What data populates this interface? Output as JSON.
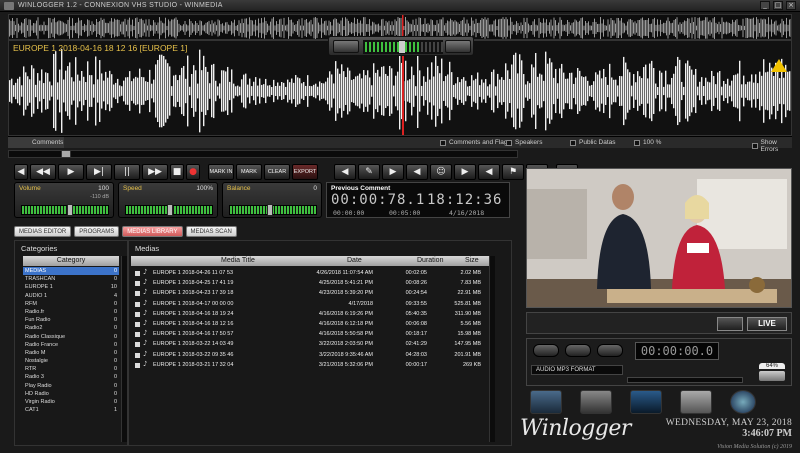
{
  "window": {
    "title": "WINLOGGER 1.2 - CONNEXION VHS STUDIO - WINMEDIA",
    "buttons": [
      "_",
      "□",
      "×"
    ]
  },
  "waveform": {
    "label": "EUROPE 1 2018-04-16 18 12 16 [EUROPE 1]",
    "warning_icon": "warning-triangle-icon"
  },
  "status": {
    "comments_tab": "Comments",
    "comments_and_flags": "Comments and Flags",
    "speakers": "Speakers",
    "public_datas": "Public Datas",
    "zoom": "100 %",
    "show_errors": "Show Errors"
  },
  "transport": {
    "buttons": [
      "◀",
      "◀◀",
      "▶",
      "▶|",
      "||",
      "▶▶",
      "■",
      "●"
    ],
    "marks": [
      "MARK IN",
      "MARK OUT",
      "CLEAR",
      "EXPORT"
    ]
  },
  "mixer": {
    "volume": {
      "label": "Volume",
      "value": "100",
      "sub": "-110 dB",
      "level": 0.55
    },
    "speed": {
      "label": "Speed",
      "value": "100%",
      "level": 0.5
    },
    "balance": {
      "label": "Balance",
      "value": "0",
      "level": 0.45
    }
  },
  "clock": {
    "label": "Previous Comment",
    "position": "00:00:78.1",
    "time": "18:12:36",
    "sub1": "00:00:00",
    "sub2": "00:05:00",
    "date": "4/16/2018"
  },
  "tabs": [
    {
      "label": "MEDIAS EDITOR",
      "active": false
    },
    {
      "label": "PROGRAMS",
      "active": false
    },
    {
      "label": "MEDIAS LIBRARY",
      "active": true
    },
    {
      "label": "MEDIAS SCAN",
      "active": false
    }
  ],
  "categories": {
    "title": "Categories",
    "header": "Category",
    "items": [
      {
        "name": "MEDIAS",
        "count": "0"
      },
      {
        "name": "TRASHCAN",
        "count": "0"
      },
      {
        "name": "EUROPE 1",
        "count": "10"
      },
      {
        "name": "AUDIO 1",
        "count": "4"
      },
      {
        "name": "RFM",
        "count": "0"
      },
      {
        "name": "Radio.fr",
        "count": "0"
      },
      {
        "name": "Fun Radio",
        "count": "0"
      },
      {
        "name": "Radio2",
        "count": "0"
      },
      {
        "name": "Radio Classique",
        "count": "0"
      },
      {
        "name": "Radio France",
        "count": "0"
      },
      {
        "name": "Radio M",
        "count": "0"
      },
      {
        "name": "Nostalgie",
        "count": "0"
      },
      {
        "name": "RTR",
        "count": "0"
      },
      {
        "name": "Radio 3",
        "count": "0"
      },
      {
        "name": "Play Radio",
        "count": "0"
      },
      {
        "name": "HD Radio",
        "count": "0"
      },
      {
        "name": "Virgin Radio",
        "count": "0"
      },
      {
        "name": "CAT1",
        "count": "1"
      }
    ]
  },
  "medias": {
    "title": "Medias",
    "columns": [
      "Media Title",
      "Date",
      "Duration",
      "Size"
    ],
    "rows": [
      {
        "title": "EUROPE 1 2018-04-26 11 07 53",
        "date": "4/26/2018 11:07:54 AM",
        "duration": "00:02:05",
        "size": "2.02 MB"
      },
      {
        "title": "EUROPE 1 2018-04-25 17 41 19",
        "date": "4/25/2018 5:41:21 PM",
        "duration": "00:08:26",
        "size": "7.83 MB"
      },
      {
        "title": "EUROPE 1 2018-04-23 17 39 18",
        "date": "4/23/2018 5:39:20 PM",
        "duration": "00:24:54",
        "size": "22.91 MB"
      },
      {
        "title": "EUROPE 1 2018-04-17 00 00 00",
        "date": "4/17/2018",
        "duration": "09:33:55",
        "size": "525.81 MB"
      },
      {
        "title": "EUROPE 1 2018-04-16 18 19 24",
        "date": "4/16/2018 6:19:26 PM",
        "duration": "05:40:35",
        "size": "311.90 MB"
      },
      {
        "title": "EUROPE 1 2018-04-16 18 12 16",
        "date": "4/16/2018 6:12:18 PM",
        "duration": "00:06:08",
        "size": "5.56 MB"
      },
      {
        "title": "EUROPE 1 2018-04-16 17 50 57",
        "date": "4/16/2018 5:50:58 PM",
        "duration": "00:18:17",
        "size": "15.98 MB"
      },
      {
        "title": "EUROPE 1 2018-03-22 14 03 49",
        "date": "3/22/2018 2:03:50 PM",
        "duration": "02:41:29",
        "size": "147.95 MB"
      },
      {
        "title": "EUROPE 1 2018-03-22 09 35 46",
        "date": "3/22/2018 9:35:46 AM",
        "duration": "04:28:03",
        "size": "201.91 MB"
      },
      {
        "title": "EUROPE 1 2018-03-21 17 32 04",
        "date": "3/21/2018 5:32:06 PM",
        "duration": "00:00:17",
        "size": "269 KB"
      }
    ]
  },
  "video": {
    "live_label": "LIVE",
    "camera_icon": "camera-icon"
  },
  "recorder": {
    "clock": "00:00:00.0",
    "format": "AUDIO MP3 FORMAT",
    "disk_percent": "64%",
    "disk_icon": "hard-disk-icon"
  },
  "dock_icons": [
    "video-wall-icon",
    "microphone-icon",
    "monitor-icon",
    "settings-icon",
    "globe-icon"
  ],
  "footer": {
    "brand": "Winlogger",
    "date": "WEDNESDAY, MAY 23, 2018",
    "time": "3:46:07 PM",
    "credit": "Vision Media Solution (c) 2019"
  },
  "colors": {
    "accent_gold": "#e6c14a",
    "selection_blue": "#3c73c9",
    "active_tab": "#d05a5a",
    "cursor_red": "#d22222",
    "meter_green": "#3fc03f"
  }
}
